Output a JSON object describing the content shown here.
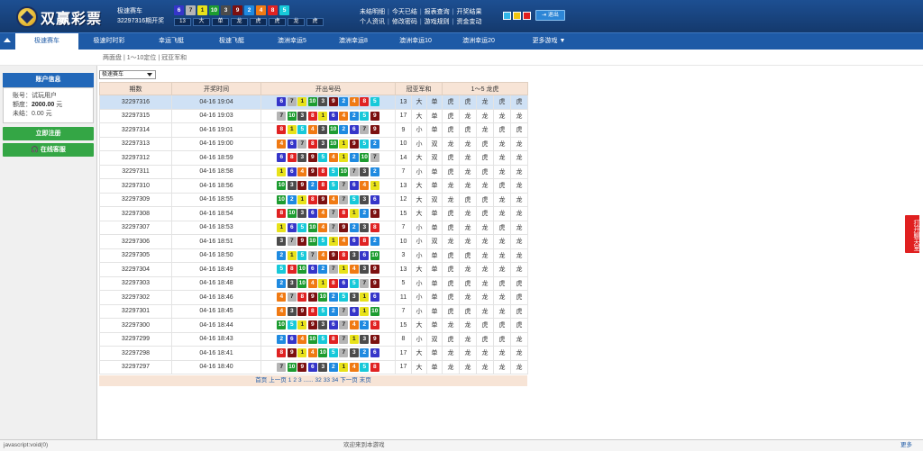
{
  "header": {
    "logo_text": "双赢彩票",
    "game_name": "极速赛车",
    "draw_label": "32297316期开奖",
    "latest_balls": [
      6,
      7,
      1,
      10,
      3,
      9,
      2,
      4,
      8,
      5
    ],
    "latest_tags": [
      "13",
      "大",
      "单",
      "龙",
      "虎",
      "虎",
      "龙",
      "虎"
    ],
    "links_row1": [
      "未结明细",
      "今天已结",
      "报表查询",
      "开奖结果"
    ],
    "links_row2": [
      "个人资讯",
      "修改密码",
      "游戏规则",
      "资金变动"
    ],
    "logout_label": "退出",
    "colors": {
      "box1": "#31b6e8",
      "box2": "#f2c511",
      "box3": "#e21f1f"
    }
  },
  "nav": {
    "items": [
      "极速赛车",
      "极速时时彩",
      "幸运飞艇",
      "极速飞艇",
      "澳洲幸运5",
      "澳洲幸运8",
      "澳洲幸运10",
      "澳洲幸运20",
      "更多游戏 ▼"
    ],
    "active_index": 0
  },
  "subnav": {
    "items": [
      "两面盘",
      "1～10定位",
      "冠亚军和"
    ]
  },
  "sidebar": {
    "account_title": "账户信息",
    "account_label": "账号：",
    "account_value": "试玩用户",
    "quota_label": "额度：",
    "quota_value": "2000.00",
    "quota_unit": "元",
    "unsettled_label": "未结：",
    "unsettled_value": "0.00 元",
    "register_label": "立即注册",
    "support_label": "在线客服"
  },
  "game_select": {
    "value": "极速赛车"
  },
  "table": {
    "headers": [
      "期数",
      "开奖时间",
      "开出号码",
      "冠亚军和",
      "1～5 龙虎"
    ],
    "rows": [
      {
        "issue": "32297316",
        "time": "04-16 19:04",
        "balls": [
          6,
          7,
          1,
          10,
          3,
          9,
          2,
          4,
          8,
          5
        ],
        "sum": "13",
        "bs": "大",
        "oe": "单",
        "dt": [
          "虎",
          "虎",
          "龙",
          "虎",
          "虎"
        ]
      },
      {
        "issue": "32297315",
        "time": "04-16 19:03",
        "balls": [
          7,
          10,
          3,
          8,
          1,
          6,
          4,
          2,
          5,
          9
        ],
        "sum": "17",
        "bs": "大",
        "oe": "单",
        "dt": [
          "虎",
          "龙",
          "龙",
          "龙",
          "龙"
        ]
      },
      {
        "issue": "32297314",
        "time": "04-16 19:01",
        "balls": [
          8,
          1,
          5,
          4,
          3,
          10,
          2,
          6,
          7,
          9
        ],
        "sum": "9",
        "bs": "小",
        "oe": "单",
        "dt": [
          "虎",
          "虎",
          "龙",
          "虎",
          "虎"
        ]
      },
      {
        "issue": "32297313",
        "time": "04-16 19:00",
        "balls": [
          4,
          6,
          7,
          8,
          3,
          10,
          1,
          9,
          5,
          2
        ],
        "sum": "10",
        "bs": "小",
        "oe": "双",
        "dt": [
          "龙",
          "龙",
          "虎",
          "龙",
          "龙"
        ]
      },
      {
        "issue": "32297312",
        "time": "04-16 18:59",
        "balls": [
          6,
          8,
          3,
          9,
          5,
          4,
          1,
          2,
          10,
          7
        ],
        "sum": "14",
        "bs": "大",
        "oe": "双",
        "dt": [
          "虎",
          "龙",
          "虎",
          "龙",
          "龙"
        ]
      },
      {
        "issue": "32297311",
        "time": "04-16 18:58",
        "balls": [
          1,
          6,
          4,
          9,
          8,
          5,
          10,
          7,
          3,
          2
        ],
        "sum": "7",
        "bs": "小",
        "oe": "单",
        "dt": [
          "虎",
          "龙",
          "虎",
          "龙",
          "龙"
        ]
      },
      {
        "issue": "32297310",
        "time": "04-16 18:56",
        "balls": [
          10,
          3,
          9,
          2,
          8,
          5,
          7,
          6,
          4,
          1
        ],
        "sum": "13",
        "bs": "大",
        "oe": "单",
        "dt": [
          "龙",
          "龙",
          "龙",
          "虎",
          "龙"
        ]
      },
      {
        "issue": "32297309",
        "time": "04-16 18:55",
        "balls": [
          10,
          2,
          1,
          8,
          9,
          4,
          7,
          5,
          3,
          6
        ],
        "sum": "12",
        "bs": "大",
        "oe": "双",
        "dt": [
          "龙",
          "虎",
          "虎",
          "龙",
          "龙"
        ]
      },
      {
        "issue": "32297308",
        "time": "04-16 18:54",
        "balls": [
          8,
          10,
          3,
          6,
          4,
          7,
          8,
          1,
          2,
          9
        ],
        "sum": "15",
        "bs": "大",
        "oe": "单",
        "dt": [
          "虎",
          "龙",
          "虎",
          "龙",
          "龙"
        ]
      },
      {
        "issue": "32297307",
        "time": "04-16 18:53",
        "balls": [
          1,
          6,
          5,
          10,
          4,
          7,
          9,
          2,
          3,
          8
        ],
        "sum": "7",
        "bs": "小",
        "oe": "单",
        "dt": [
          "虎",
          "龙",
          "龙",
          "虎",
          "龙"
        ]
      },
      {
        "issue": "32297306",
        "time": "04-16 18:51",
        "balls": [
          3,
          7,
          9,
          10,
          5,
          1,
          4,
          6,
          8,
          2
        ],
        "sum": "10",
        "bs": "小",
        "oe": "双",
        "dt": [
          "龙",
          "龙",
          "龙",
          "龙",
          "龙"
        ]
      },
      {
        "issue": "32297305",
        "time": "04-16 18:50",
        "balls": [
          2,
          1,
          5,
          7,
          4,
          9,
          8,
          3,
          6,
          10
        ],
        "sum": "3",
        "bs": "小",
        "oe": "单",
        "dt": [
          "虎",
          "虎",
          "龙",
          "龙",
          "龙"
        ]
      },
      {
        "issue": "32297304",
        "time": "04-16 18:49",
        "balls": [
          5,
          8,
          10,
          6,
          2,
          7,
          1,
          4,
          3,
          9
        ],
        "sum": "13",
        "bs": "大",
        "oe": "单",
        "dt": [
          "虎",
          "龙",
          "龙",
          "龙",
          "龙"
        ]
      },
      {
        "issue": "32297303",
        "time": "04-16 18:48",
        "balls": [
          2,
          3,
          10,
          4,
          1,
          8,
          6,
          5,
          7,
          9
        ],
        "sum": "5",
        "bs": "小",
        "oe": "单",
        "dt": [
          "虎",
          "虎",
          "龙",
          "虎",
          "虎"
        ]
      },
      {
        "issue": "32297302",
        "time": "04-16 18:46",
        "balls": [
          4,
          7,
          8,
          9,
          10,
          2,
          5,
          3,
          1,
          6
        ],
        "sum": "11",
        "bs": "小",
        "oe": "单",
        "dt": [
          "虎",
          "龙",
          "龙",
          "龙",
          "虎"
        ]
      },
      {
        "issue": "32297301",
        "time": "04-16 18:45",
        "balls": [
          4,
          3,
          9,
          8,
          5,
          2,
          7,
          6,
          1,
          10
        ],
        "sum": "7",
        "bs": "小",
        "oe": "单",
        "dt": [
          "虎",
          "虎",
          "龙",
          "龙",
          "虎"
        ]
      },
      {
        "issue": "32297300",
        "time": "04-16 18:44",
        "balls": [
          10,
          5,
          1,
          9,
          3,
          6,
          7,
          4,
          2,
          8
        ],
        "sum": "15",
        "bs": "大",
        "oe": "单",
        "dt": [
          "龙",
          "龙",
          "虎",
          "虎",
          "虎"
        ]
      },
      {
        "issue": "32297299",
        "time": "04-16 18:43",
        "balls": [
          2,
          6,
          4,
          10,
          5,
          8,
          7,
          1,
          3,
          9
        ],
        "sum": "8",
        "bs": "小",
        "oe": "双",
        "dt": [
          "虎",
          "龙",
          "虎",
          "虎",
          "龙"
        ]
      },
      {
        "issue": "32297298",
        "time": "04-16 18:41",
        "balls": [
          8,
          9,
          1,
          4,
          10,
          5,
          7,
          3,
          2,
          6
        ],
        "sum": "17",
        "bs": "大",
        "oe": "单",
        "dt": [
          "龙",
          "龙",
          "龙",
          "龙",
          "龙"
        ]
      },
      {
        "issue": "32297297",
        "time": "04-16 18:40",
        "balls": [
          7,
          10,
          9,
          6,
          3,
          2,
          1,
          4,
          5,
          8
        ],
        "sum": "17",
        "bs": "大",
        "oe": "单",
        "dt": [
          "龙",
          "龙",
          "龙",
          "龙",
          "龙"
        ]
      }
    ]
  },
  "ball_colors": {
    "1": "#e8e21a",
    "2": "#1f8ae0",
    "3": "#4b4b4b",
    "4": "#f07a13",
    "5": "#17c9d9",
    "6": "#3535c9",
    "7": "#b5b5b5",
    "8": "#e02222",
    "9": "#7c1010",
    "10": "#1d9c30"
  },
  "pager": {
    "first": "首页",
    "prev": "上一页",
    "pages": [
      "1",
      "2",
      "3",
      "......",
      "32",
      "33",
      "34"
    ],
    "next": "下一页",
    "last": "末页"
  },
  "side_tab": {
    "label": "打开聊天室"
  },
  "statusbar": {
    "left": "javascript:void(0)",
    "center": "欢迎来到本游戏",
    "right": "更多"
  }
}
